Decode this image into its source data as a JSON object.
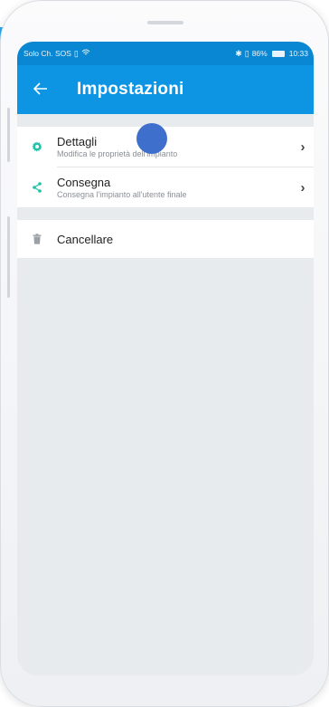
{
  "status_bar": {
    "carrier": "Solo Ch. SOS",
    "battery": "86%",
    "time": "10:33"
  },
  "app_bar": {
    "title": "Impostazioni"
  },
  "settings": [
    {
      "title": "Dettagli",
      "subtitle": "Modifica le proprietà dell'impianto",
      "icon": "gear-icon"
    },
    {
      "title": "Consegna",
      "subtitle": "Consegna l'impianto all'utente finale",
      "icon": "share-icon"
    }
  ],
  "danger": {
    "title": "Cancellare",
    "icon": "trash-icon"
  },
  "colors": {
    "app_bar": "#0d95e3",
    "status_bar": "#0a87d2",
    "icon_accent": "#1fc3a9",
    "background": "#e8ebee"
  }
}
